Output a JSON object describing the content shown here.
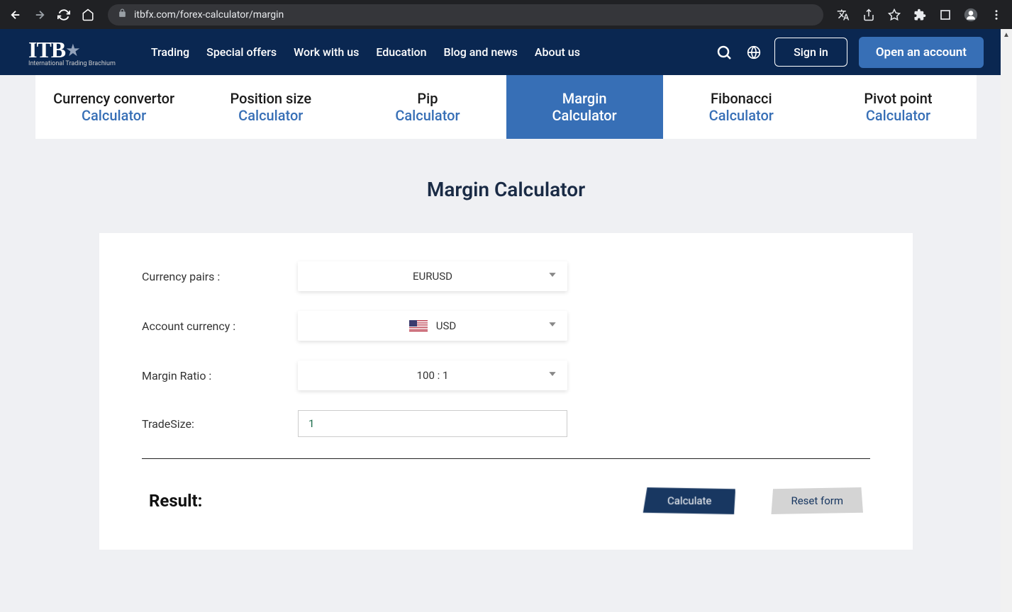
{
  "browser": {
    "url": "itbfx.com/forex-calculator/margin"
  },
  "header": {
    "logo_text": "ITB",
    "logo_subtitle": "International Trading Brachium",
    "nav": [
      "Trading",
      "Special offers",
      "Work with us",
      "Education",
      "Blog and news",
      "About us"
    ],
    "signin": "Sign in",
    "open_account": "Open an account"
  },
  "tabs": [
    {
      "title": "Currency convertor",
      "sub": "Calculator",
      "active": false
    },
    {
      "title": "Position size",
      "sub": "Calculator",
      "active": false
    },
    {
      "title": "Pip",
      "sub": "Calculator",
      "active": false
    },
    {
      "title": "Margin",
      "sub": "Calculator",
      "active": true
    },
    {
      "title": "Fibonacci",
      "sub": "Calculator",
      "active": false
    },
    {
      "title": "Pivot point",
      "sub": "Calculator",
      "active": false
    }
  ],
  "page_title": "Margin Calculator",
  "form": {
    "currency_pairs_label": "Currency pairs :",
    "currency_pairs_value": "EURUSD",
    "account_currency_label": "Account currency :",
    "account_currency_value": "USD",
    "margin_ratio_label": "Margin Ratio :",
    "margin_ratio_value": "100 : 1",
    "trade_size_label": "TradeSize:",
    "trade_size_value": "1"
  },
  "result_label": "Result:",
  "calculate_btn": "Calculate",
  "reset_btn": "Reset form"
}
